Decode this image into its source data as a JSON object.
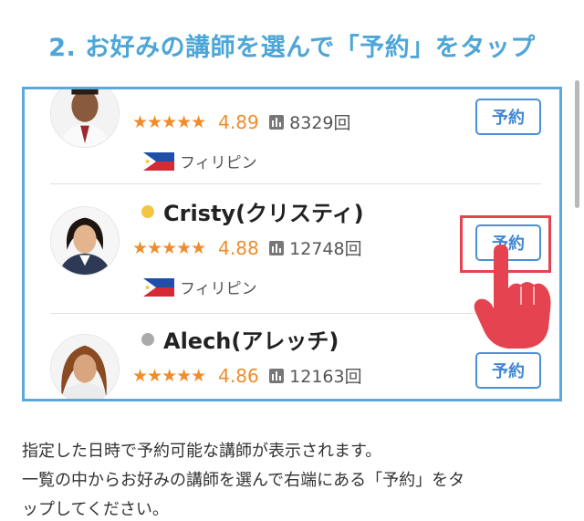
{
  "title": "2. お好みの講師を選んで「予約」をタップ",
  "teachers": [
    {
      "name": "",
      "status_color": "",
      "stars": "★★★★★",
      "rating": "4.89",
      "lessons": "8329回",
      "country": "フィリピン",
      "button": "予約"
    },
    {
      "name": "Cristy(クリスティ)",
      "status_color": "#f4c542",
      "stars": "★★★★★",
      "rating": "4.88",
      "lessons": "12748回",
      "country": "フィリピン",
      "button": "予約"
    },
    {
      "name": "Alech(アレッチ)",
      "status_color": "#aaaaaa",
      "stars": "★★★★★",
      "rating": "4.86",
      "lessons": "12163回",
      "country": "",
      "button": "予約"
    }
  ],
  "description": [
    "指定した日時で予約可能な講師が表示されます。",
    "一覧の中からお好みの講師を選んで右端にある「予約」をタ",
    "ップしてください。"
  ],
  "colors": {
    "accent": "#4da6d8",
    "star": "#f08c2b",
    "button": "#3f86d4",
    "highlight": "#e5434f"
  }
}
